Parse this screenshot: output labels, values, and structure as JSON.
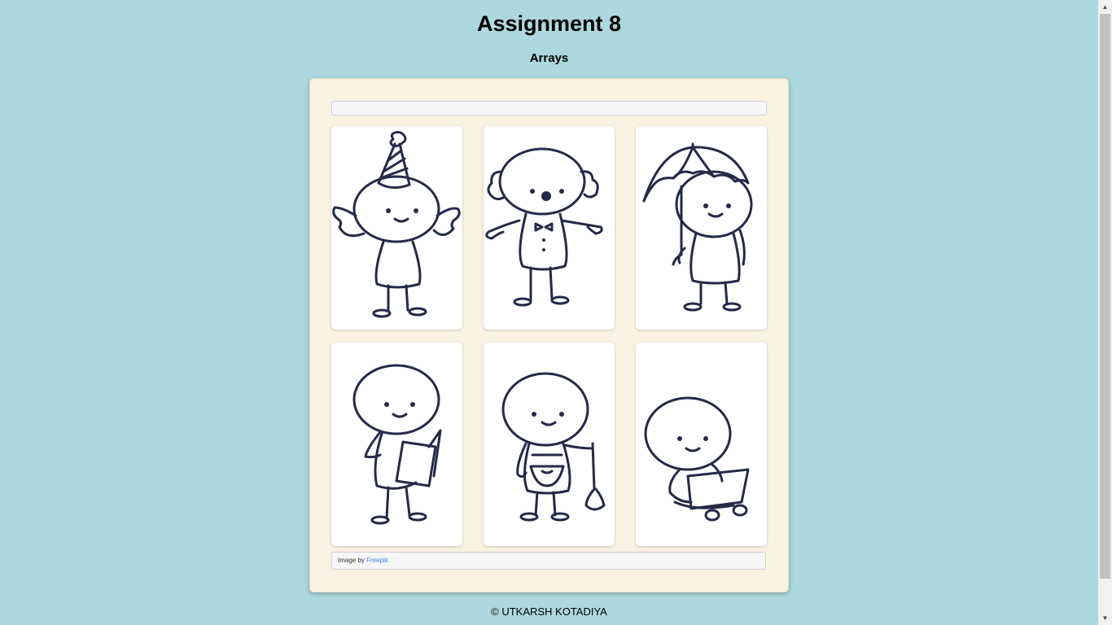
{
  "header": {
    "title": "Assignment 8",
    "subtitle": "Arrays"
  },
  "gallery": {
    "tiles": [
      {
        "icon": "party-hat-figure-icon"
      },
      {
        "icon": "clown-figure-icon"
      },
      {
        "icon": "umbrella-figure-icon"
      },
      {
        "icon": "reading-figure-icon"
      },
      {
        "icon": "gardener-figure-icon"
      },
      {
        "icon": "laptop-figure-icon"
      }
    ]
  },
  "credit": {
    "prefix": "Image by",
    "link_text": "Freepik"
  },
  "footer": {
    "text": "© UTKARSH KOTADIYA"
  },
  "colors": {
    "page_bg": "#add8df",
    "card_bg": "#faf2e1",
    "ink": "#252a48",
    "link": "#3b82f6"
  }
}
